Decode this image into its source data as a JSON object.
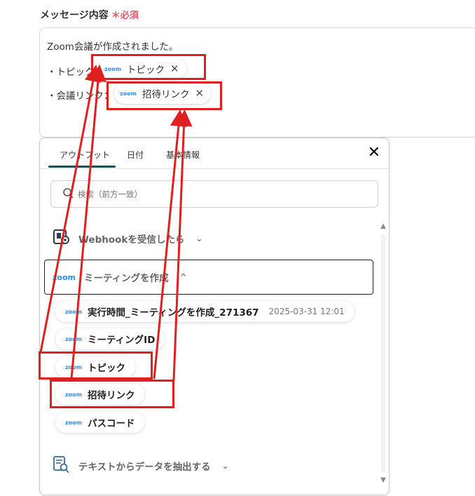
{
  "field": {
    "label": "メッセージ内容",
    "required_mark": "＊必須"
  },
  "message": {
    "line1": "Zoom会議が作成されました。",
    "topic_prefix": "・トピック：",
    "link_prefix": "・会議リンク：",
    "chips": [
      {
        "logo": "zoom",
        "label": "トピック",
        "close": "✕"
      },
      {
        "logo": "zoom",
        "label": "招待リンク",
        "close": "✕"
      }
    ]
  },
  "panel": {
    "tabs": [
      "アウトプット",
      "日付",
      "基本情報"
    ],
    "close": "✕",
    "search_placeholder": "検索（前方一致）",
    "sections": [
      {
        "icon": "webhook-icon",
        "label": "Webhookを受信したら",
        "chevron": "⌄"
      },
      {
        "icon": "zoom-logo",
        "logo": "zoom",
        "label": "ミーティングを作成",
        "chevron": "^"
      },
      {
        "icon": "text-extract-icon",
        "label": "テキストからデータを抽出する",
        "chevron": "⌄"
      }
    ],
    "outputs": [
      {
        "logo": "zoom",
        "label": "実行時間_ミーティングを作成_271367",
        "meta": "2025-03-31 12:01"
      },
      {
        "logo": "zoom",
        "label": "ミーティングID"
      },
      {
        "logo": "zoom",
        "label": "トピック"
      },
      {
        "logo": "zoom",
        "label": "招待リンク"
      },
      {
        "logo": "zoom",
        "label": "パスコード"
      }
    ]
  },
  "colors": {
    "annotation": "#e02020",
    "zoom": "#2d8cff",
    "tab_active": "#1f4e5a",
    "required": "#e05a6b"
  }
}
